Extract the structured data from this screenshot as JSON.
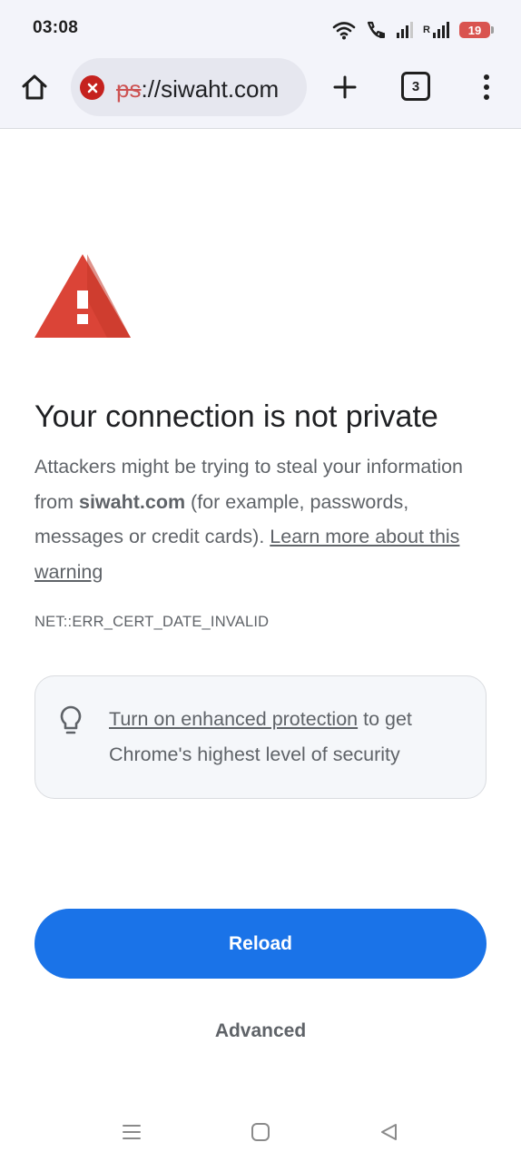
{
  "status_bar": {
    "time": "03:08",
    "roaming_label": "R",
    "battery_level": "19",
    "icons": [
      "wifi-icon",
      "volte-call-icon",
      "signal-icon",
      "signal-icon",
      "battery-icon"
    ],
    "battery_color": "#d9534f"
  },
  "toolbar": {
    "url_scheme_fragment": "ps",
    "url_rest": "://siwaht.com",
    "tab_count": "3",
    "icons": [
      "home-icon",
      "security-error-icon",
      "plus-icon",
      "tabs-icon",
      "more-vert-icon"
    ]
  },
  "interstitial": {
    "title": "Your connection is not private",
    "body_part1": "Attackers might be trying to steal your information from ",
    "body_domain": "siwaht.com",
    "body_part2": " (for example, passwords, messages or credit cards). ",
    "learn_more_link": "Learn more about this warning",
    "error_code": "NET::ERR_CERT_DATE_INVALID",
    "warning_color": "#db4437"
  },
  "enhanced_protection": {
    "link_text": "Turn on enhanced protection",
    "rest_text": " to get Chrome's highest level of security",
    "icon": "lightbulb-icon"
  },
  "actions": {
    "reload_label": "Reload",
    "advanced_label": "Advanced",
    "primary_color": "#1a73e8"
  },
  "nav_bar": {
    "icons": [
      "recents-icon",
      "home-square-icon",
      "back-icon"
    ]
  }
}
